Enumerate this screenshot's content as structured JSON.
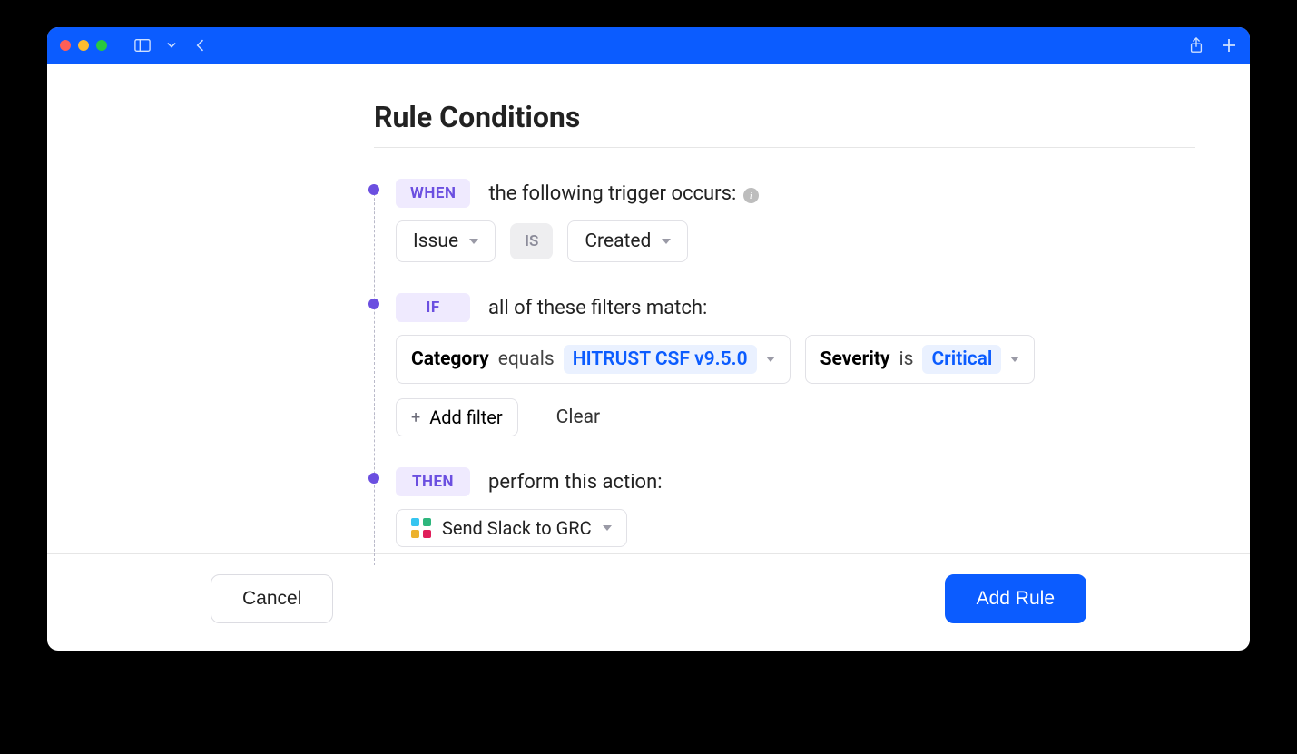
{
  "window": {
    "accent": "#0B5CFF"
  },
  "page": {
    "title": "Rule Conditions"
  },
  "sections": {
    "when": {
      "badge": "WHEN",
      "text": "the following trigger occurs:",
      "subject": "Issue",
      "operator": "IS",
      "predicate": "Created"
    },
    "if": {
      "badge": "IF",
      "text": "all of these filters match:",
      "filters": [
        {
          "field": "Category",
          "op": "equals",
          "value": "HITRUST CSF v9.5.0"
        },
        {
          "field": "Severity",
          "op": "is",
          "value": "Critical"
        }
      ],
      "add_label": "Add filter",
      "clear_label": "Clear"
    },
    "then": {
      "badge": "THEN",
      "text": "perform this action:",
      "action": "Send Slack to GRC"
    }
  },
  "footer": {
    "cancel": "Cancel",
    "submit": "Add Rule"
  }
}
